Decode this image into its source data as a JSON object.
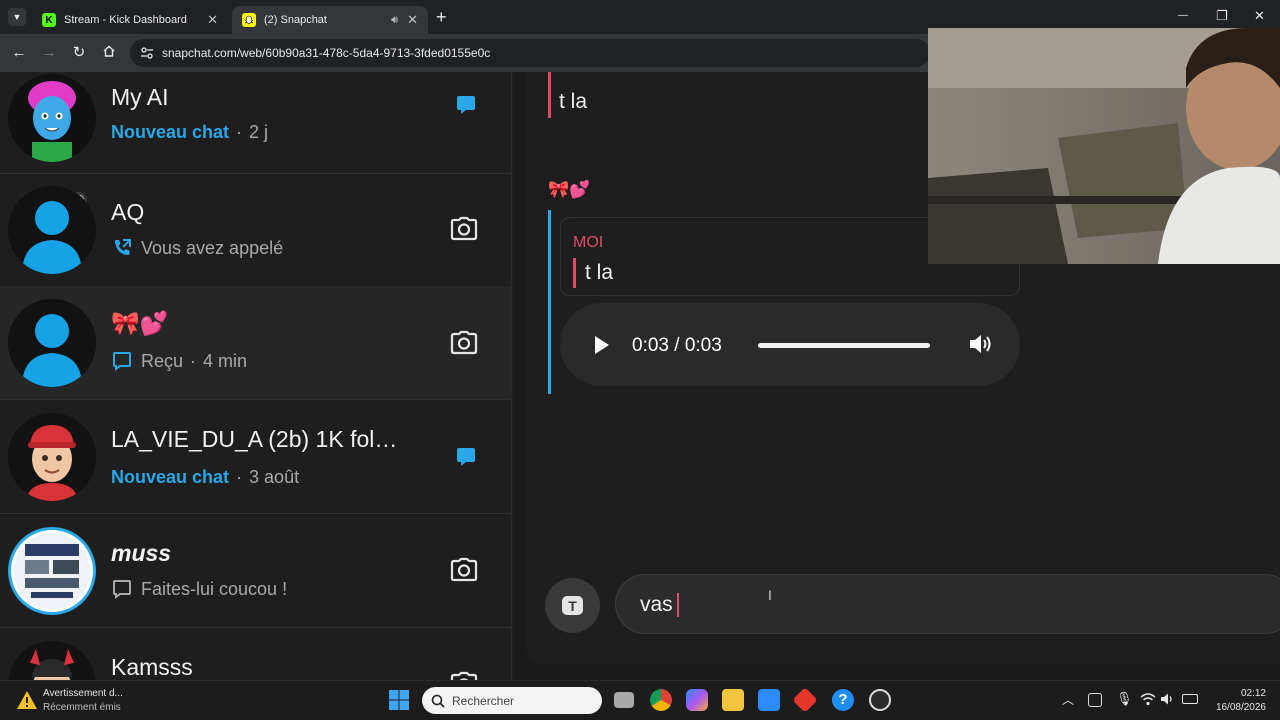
{
  "browser": {
    "tabs": [
      {
        "title": "Stream - Kick Dashboard",
        "favicon": "K"
      },
      {
        "title": "(2) Snapchat"
      }
    ],
    "url": "snapchat.com/web/60b90a31-478c-5da4-9713-3fded0155e0c",
    "new_tab": "+",
    "window": {
      "minimize": "—",
      "restore": "❐",
      "close": "✕"
    }
  },
  "chats": [
    {
      "name": "My AI",
      "status_new": "Nouveau chat",
      "time": "2 j",
      "side_icon": "chat-bubble-icon"
    },
    {
      "name": "AQ",
      "status": "Vous avez appelé",
      "status_icon": "call-arrow-icon",
      "side_icon": "camera-icon"
    },
    {
      "name": "🎀💕",
      "status": "Reçu",
      "time": "4 min",
      "status_icon": "chat-outline-icon",
      "side_icon": "camera-icon"
    },
    {
      "name": "LA_VIE_DU_A (2b) 1K fol…",
      "status_new": "Nouveau chat",
      "time": "3 août",
      "side_icon": "chat-bubble-icon"
    },
    {
      "name": "muss",
      "status": "Faites-lui coucou !",
      "status_icon": "chat-outline-icon",
      "side_icon": "camera-icon"
    },
    {
      "name": "Kamsss"
    }
  ],
  "conversation": {
    "prev_message": "t la",
    "sender_emoji": "🎀💕",
    "quote_sender": "MOI",
    "quote_text": "t la",
    "audio": {
      "time": "0:03 / 0:03",
      "progress": 1.0
    },
    "input_value": "vas"
  },
  "taskbar": {
    "notification_title": "Avertissement d...",
    "notification_sub": "Récemment émis",
    "search_placeholder": "Rechercher",
    "time": "02:12",
    "date": "16/08/2026"
  },
  "colors": {
    "accent_blue": "#2aa7e7",
    "accent_red": "#e04a6a",
    "audio_bar": "#2a2a2a"
  }
}
